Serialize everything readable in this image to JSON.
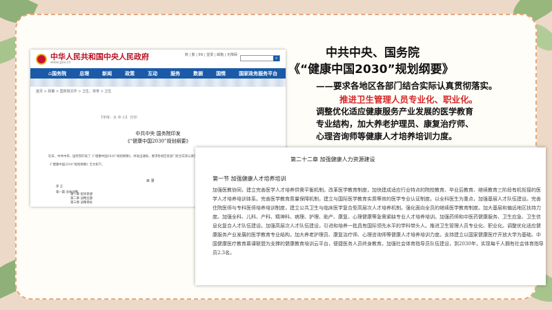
{
  "screenshot": {
    "site_name": "中华人民共和国中央人民政府",
    "site_url": "www.gov.cn",
    "top_links": "简 | 繁 | EN | 登录 | 邮箱 | 无障碍",
    "nav": [
      "国务院",
      "总理",
      "新闻",
      "政策",
      "互动",
      "服务",
      "数据",
      "国情",
      "国家政务服务平台"
    ],
    "breadcrumb": "首页 > 政策 > 国务院文件 > 卫生、体育 > 卫生",
    "toolbar": "【字体：大 中 小】 打印",
    "doc_title_line1": "中共中央 国务院印发",
    "doc_title_line2": "《“健康中国2030”规划纲要》",
    "body_text": "近日，中共中央、国务院印发了《“健康中国2030”规划纲要》，并发出通知，要求各地区各部门结合实际认真贯彻落实。",
    "body_text2": "《“健康中国2030”规划纲要》全文如下。",
    "toc_heading": "目 录",
    "toc": [
      "序 言",
      "第一篇 总体战略"
    ],
    "toc_chapters": [
      "第一章 指导思想",
      "第二章 战略主题",
      "第三章 战略目标"
    ]
  },
  "heading": {
    "org": "中共中央、国务院",
    "plan": "《“健康中国2030”规划纲要》",
    "requirement": "——要求各地区各部门结合实际认真贯彻落实。",
    "highlight": "推进卫生管理人员专业化、职业化。",
    "lines": [
      "调整优化适应健康服务产业发展的医学教育",
      "专业结构，加大养老护理员、康复治疗师、",
      "心理咨询师等健康人才培养培训力度。"
    ]
  },
  "excerpt": {
    "chapter": "第二十二章 加强健康人力资源建设",
    "section": "第一节 加强健康人才培养培训",
    "paragraph": "加强医教协同，建立完善医学人才培养供需平衡机制。改革医学教育制度，加快建成适应行业特点的院校教育、毕业后教育、继续教育三阶段有机衔接的医学人才培养培训体系。完善医学教育质量保障机制，建立与国际医学教育实质等效的医学专业认证制度。以全科医生为重点，加强基层人才队伍建设。完善住院医师与专科医师培养培训制度，建立公共卫生与临床医学复合型高层次人才培养机制。强化面向全员的继续医学教育制度。加大基层和偏远地区扶持力度。加强全科、儿科、产科、精神科、病理、护理、助产、康复、心理健康等急需紧缺专业人才培养培训。加强药师和中医药健康服务、卫生应急、卫生信息化复合人才队伍建设。加强高层次人才队伍建设，引进和培养一批具有国际领先水平的学科带头人。推进卫生管理人员专业化、职业化。调整优化适应健康服务产业发展的医学教育专业结构，加大养老护理员、康复治疗师、心理咨询师等健康人才培养培训力度。支持建立以国家健康医疗开放大学为基础、中国健康医疗教育慕课联盟为支撑的健康教育培训云平台，便捷医务人员终身教育。加强社会体育指导员队伍建设，到2030年，实现每千人拥有社会体育指导员2.3名。"
  },
  "colors": {
    "background": "#ecd9c8",
    "card_border": "#e8a77a",
    "gov_red": "#b8101f",
    "nav_blue": "#1a5aa8",
    "highlight_red": "#d62828"
  }
}
